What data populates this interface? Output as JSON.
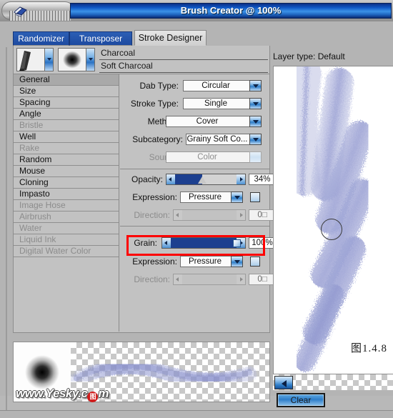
{
  "window": {
    "title": "Brush Creator @ 100%",
    "handle_icon": "paint-cup-icon"
  },
  "tabs": [
    {
      "label": "Randomizer",
      "active": false
    },
    {
      "label": "Transposer",
      "active": false
    },
    {
      "label": "Stroke Designer",
      "active": true
    }
  ],
  "brush": {
    "category": "Charcoal",
    "variant": "Soft Charcoal"
  },
  "categories": [
    {
      "label": "General",
      "selected": true,
      "enabled": true
    },
    {
      "label": "Size",
      "selected": false,
      "enabled": true
    },
    {
      "label": "Spacing",
      "selected": false,
      "enabled": true
    },
    {
      "label": "Angle",
      "selected": false,
      "enabled": true
    },
    {
      "label": "Bristle",
      "selected": false,
      "enabled": false
    },
    {
      "label": "Well",
      "selected": false,
      "enabled": true
    },
    {
      "label": "Rake",
      "selected": false,
      "enabled": false
    },
    {
      "label": "Random",
      "selected": false,
      "enabled": true
    },
    {
      "label": "Mouse",
      "selected": false,
      "enabled": true
    },
    {
      "label": "Cloning",
      "selected": false,
      "enabled": true
    },
    {
      "label": "Impasto",
      "selected": false,
      "enabled": true
    },
    {
      "label": "Image Hose",
      "selected": false,
      "enabled": false
    },
    {
      "label": "Airbrush",
      "selected": false,
      "enabled": false
    },
    {
      "label": "Water",
      "selected": false,
      "enabled": false
    },
    {
      "label": "Liquid Ink",
      "selected": false,
      "enabled": false
    },
    {
      "label": "Digital Water Color",
      "selected": false,
      "enabled": false
    }
  ],
  "settings": {
    "dab_type": {
      "label": "Dab Type:",
      "value": "Circular"
    },
    "stroke_type": {
      "label": "Stroke Type:",
      "value": "Single"
    },
    "method": {
      "label": "Method:",
      "value": "Cover"
    },
    "subcategory": {
      "label": "Subcategory:",
      "value": "Grainy Soft Co..."
    },
    "source": {
      "label": "Source:",
      "value": "Color"
    },
    "opacity": {
      "label": "Opacity:",
      "value": "34%",
      "percent": 34
    },
    "opacity_expression": {
      "label": "Expression:",
      "value": "Pressure"
    },
    "opacity_direction": {
      "label": "Direction:",
      "value": "0□"
    },
    "grain": {
      "label": "Grain:",
      "value": "100%",
      "percent": 100
    },
    "grain_expression": {
      "label": "Expression:",
      "value": "Pressure"
    },
    "grain_direction": {
      "label": "Direction:",
      "value": "0□"
    }
  },
  "right_pane": {
    "layer_type": "Layer type: Default",
    "figure_caption": "图1.4.8",
    "clear_label": "Clear",
    "back_icon": "left-arrow-icon"
  },
  "watermark": {
    "prefix": "www.Yesky.c",
    "seal": "图",
    "suffix": "m"
  },
  "colors": {
    "accent_blue": "#1c3f8f",
    "titlebar_blue": "#1057c4",
    "highlight_red": "#ff0000",
    "panel_gray": "#c2c2c2",
    "window_gray": "#b4b4b4"
  }
}
